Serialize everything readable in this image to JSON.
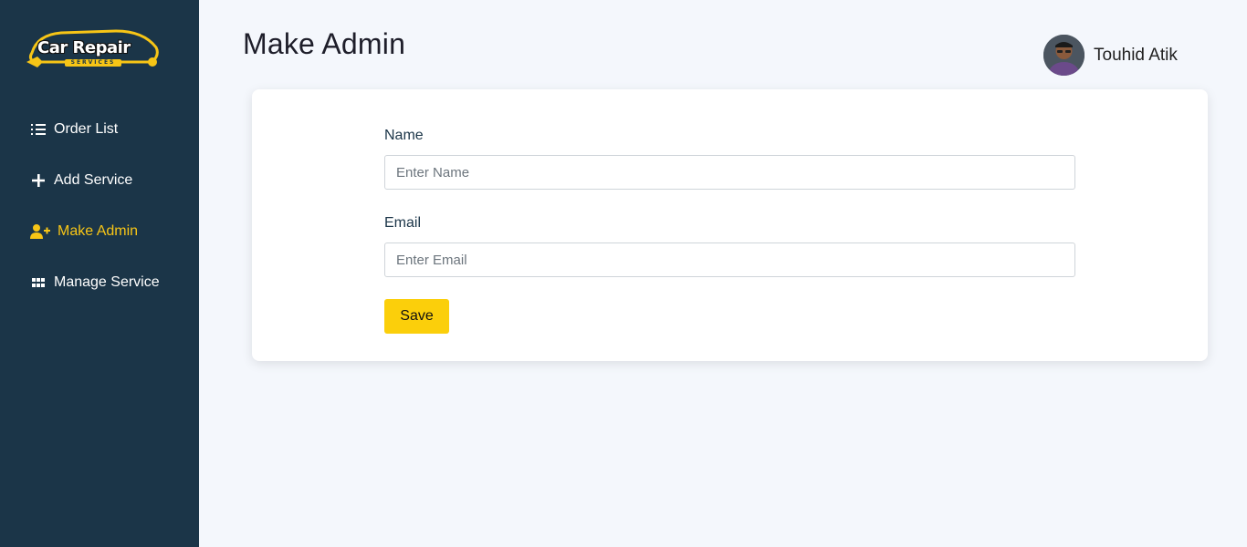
{
  "brand": {
    "name": "Car Repair",
    "tagline": "SERVICES",
    "accent_color": "#f7c516",
    "sidebar_color": "#1b3548"
  },
  "sidebar": {
    "items": [
      {
        "label": "Order List",
        "icon": "ordered-list-icon",
        "active": false
      },
      {
        "label": "Add Service",
        "icon": "plus-icon",
        "active": false
      },
      {
        "label": "Make Admin",
        "icon": "user-plus-icon",
        "active": true
      },
      {
        "label": "Manage Service",
        "icon": "grid-icon",
        "active": false
      }
    ]
  },
  "header": {
    "title": "Make Admin",
    "user_name": "Touhid Atik"
  },
  "form": {
    "name_label": "Name",
    "name_placeholder": "Enter Name",
    "name_value": "",
    "email_label": "Email",
    "email_placeholder": "Enter Email",
    "email_value": "",
    "save_label": "Save",
    "save_color": "#fbcf0b"
  }
}
